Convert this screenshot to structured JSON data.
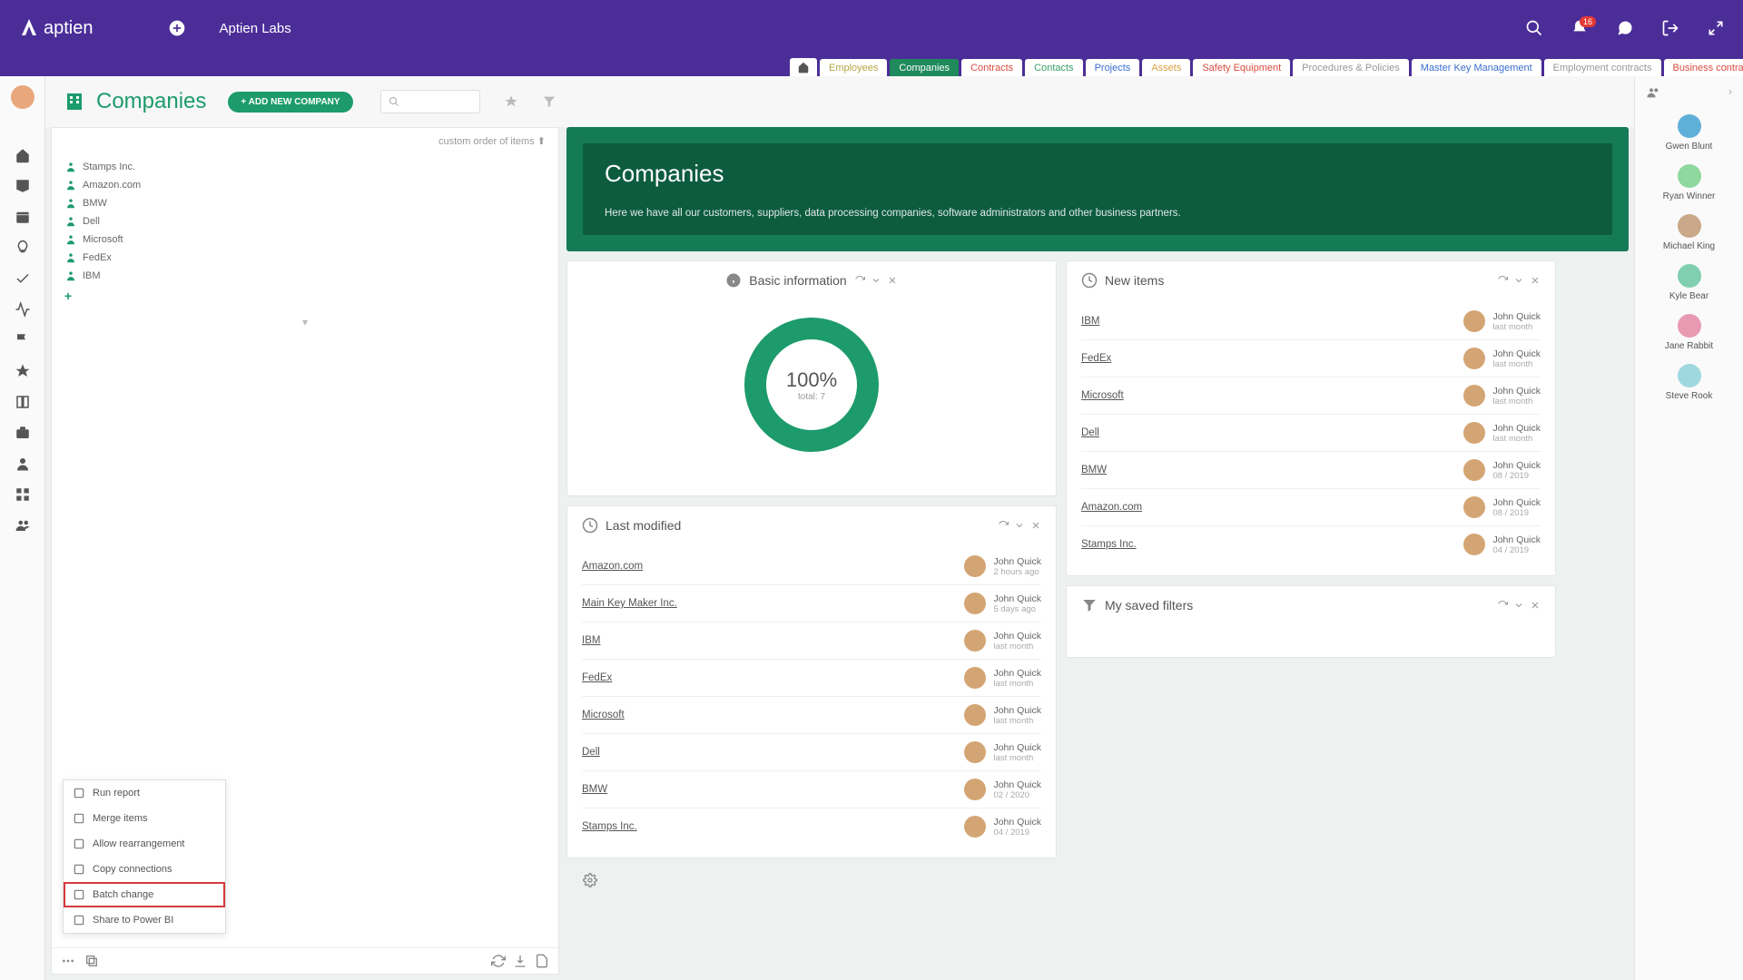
{
  "header": {
    "brand": "aptien",
    "org": "Aptien Labs",
    "notification_count": "16"
  },
  "tabs": [
    {
      "label": "",
      "color": "#555"
    },
    {
      "label": "Employees",
      "color": "#b5a642"
    },
    {
      "label": "Companies",
      "color": "#fff",
      "active": true
    },
    {
      "label": "Contracts",
      "color": "#d84c3f"
    },
    {
      "label": "Contacts",
      "color": "#3aa065"
    },
    {
      "label": "Projects",
      "color": "#3a6ecf"
    },
    {
      "label": "Assets",
      "color": "#d8a23f"
    },
    {
      "label": "Safety Equipment",
      "color": "#d84c3f"
    },
    {
      "label": "Procedures & Policies",
      "color": "#999"
    },
    {
      "label": "Master Key Management",
      "color": "#3a6ecf"
    },
    {
      "label": "Employment contracts",
      "color": "#999"
    },
    {
      "label": "Business contracts",
      "color": "#d84c3f"
    }
  ],
  "page": {
    "title": "Companies",
    "add_button": "+ ADD NEW COMPANY"
  },
  "tree": {
    "order_label": "custom order of items",
    "items": [
      {
        "name": "Stamps Inc."
      },
      {
        "name": "Amazon.com"
      },
      {
        "name": "BMW"
      },
      {
        "name": "Dell"
      },
      {
        "name": "Microsoft"
      },
      {
        "name": "FedEx"
      },
      {
        "name": "IBM"
      }
    ]
  },
  "context_menu": [
    {
      "label": "Run report"
    },
    {
      "label": "Merge items"
    },
    {
      "label": "Allow rearrangement"
    },
    {
      "label": "Copy connections"
    },
    {
      "label": "Batch change",
      "highlighted": true
    },
    {
      "label": "Share to Power BI"
    }
  ],
  "hero": {
    "title": "Companies",
    "sub": "Here we have all our customers, suppliers, data processing companies, software administrators and other business partners."
  },
  "widgets": {
    "basic": {
      "title": "Basic information",
      "pct": "100%",
      "total": "total: 7"
    },
    "modified": {
      "title": "Last modified",
      "rows": [
        {
          "name": "Amazon.com",
          "user": "John Quick",
          "time": "2 hours ago"
        },
        {
          "name": "Main Key Maker Inc.",
          "user": "John Quick",
          "time": "5 days ago"
        },
        {
          "name": "IBM",
          "user": "John Quick",
          "time": "last month"
        },
        {
          "name": "FedEx",
          "user": "John Quick",
          "time": "last month"
        },
        {
          "name": "Microsoft",
          "user": "John Quick",
          "time": "last month"
        },
        {
          "name": "Dell",
          "user": "John Quick",
          "time": "last month"
        },
        {
          "name": "BMW",
          "user": "John Quick",
          "time": "02 / 2020"
        },
        {
          "name": "Stamps Inc.",
          "user": "John Quick",
          "time": "04 / 2019"
        }
      ]
    },
    "newitems": {
      "title": "New items",
      "rows": [
        {
          "name": "IBM",
          "user": "John Quick",
          "time": "last month"
        },
        {
          "name": "FedEx",
          "user": "John Quick",
          "time": "last month"
        },
        {
          "name": "Microsoft",
          "user": "John Quick",
          "time": "last month"
        },
        {
          "name": "Dell",
          "user": "John Quick",
          "time": "last month"
        },
        {
          "name": "BMW",
          "user": "John Quick",
          "time": "08 / 2019"
        },
        {
          "name": "Amazon.com",
          "user": "John Quick",
          "time": "08 / 2019"
        },
        {
          "name": "Stamps Inc.",
          "user": "John Quick",
          "time": "04 / 2019"
        }
      ]
    },
    "filters": {
      "title": "My saved filters"
    }
  },
  "right_rail": [
    {
      "name": "Gwen Blunt",
      "color": "#5fb0d8"
    },
    {
      "name": "Ryan Winner",
      "color": "#8fd89e"
    },
    {
      "name": "Michael King",
      "color": "#c9a889"
    },
    {
      "name": "Kyle Bear",
      "color": "#7fcfb0"
    },
    {
      "name": "Jane Rabbit",
      "color": "#e89ab2"
    },
    {
      "name": "Steve Rook",
      "color": "#a0d8e0"
    }
  ]
}
